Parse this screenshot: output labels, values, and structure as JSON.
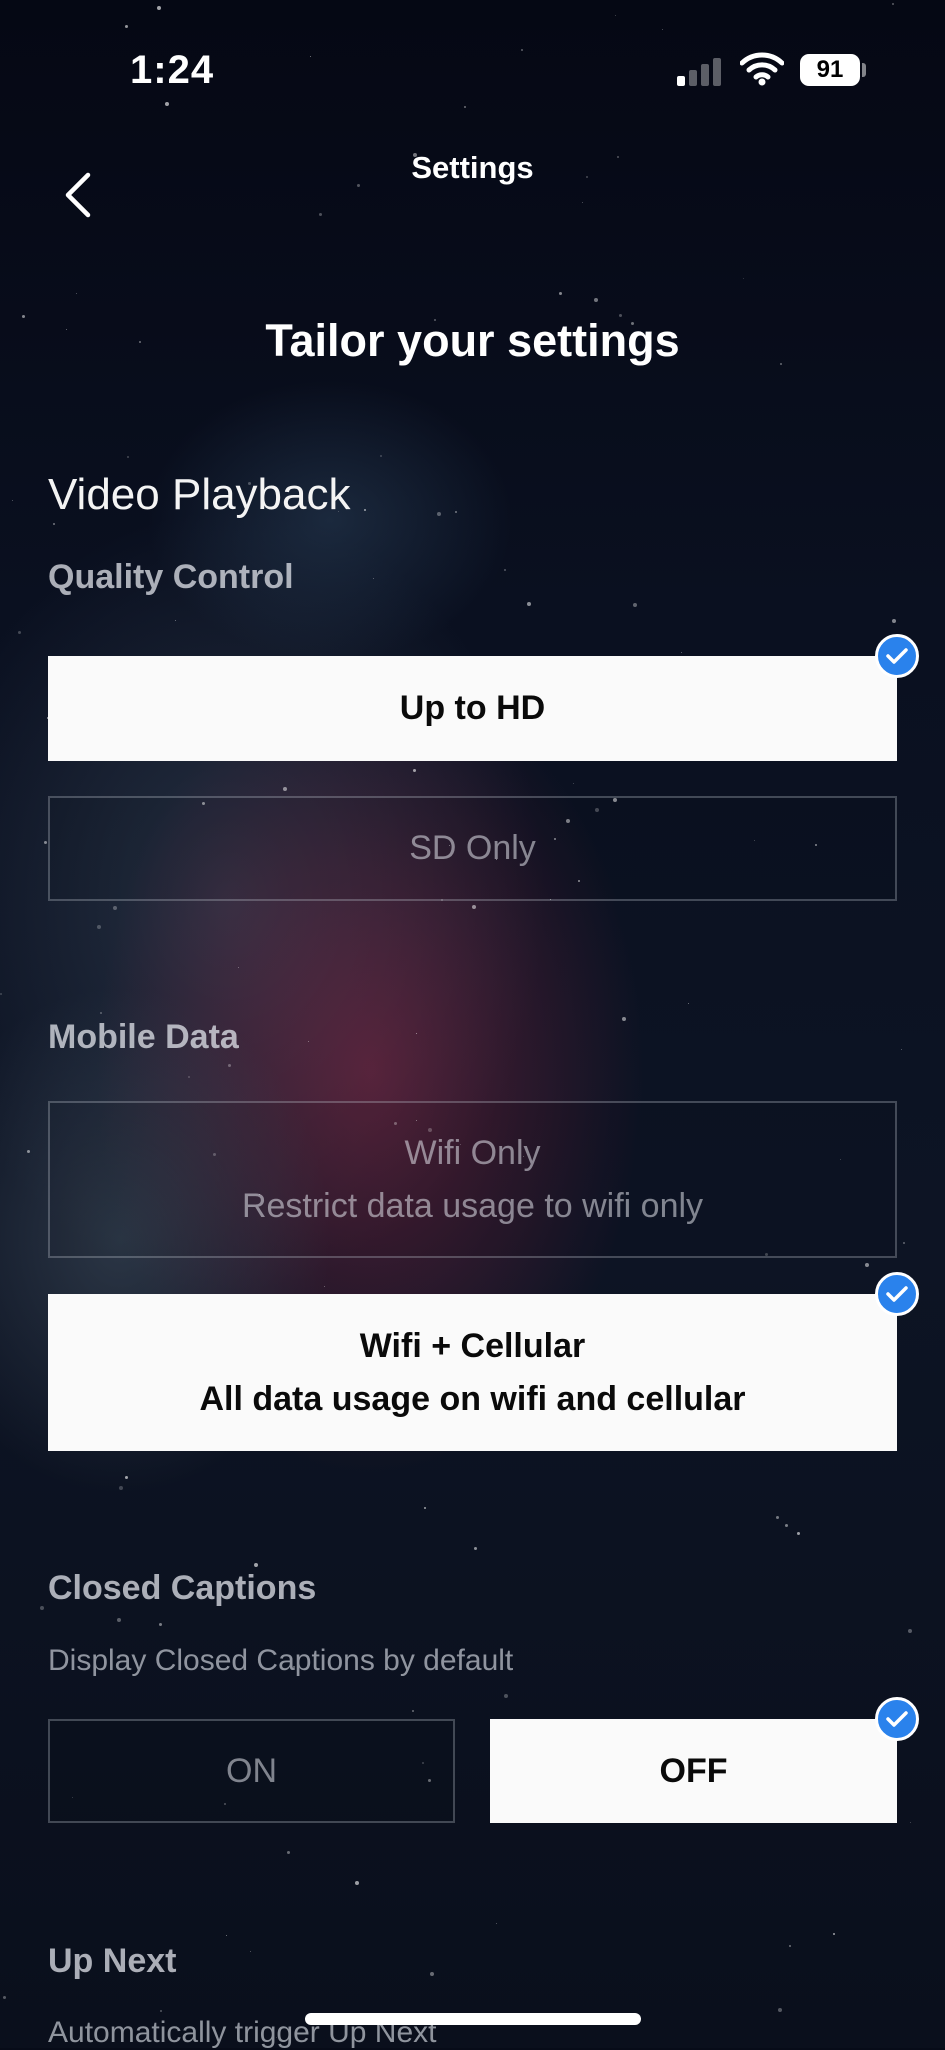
{
  "status_bar": {
    "time": "1:24",
    "battery": "91"
  },
  "nav": {
    "title": "Settings",
    "back_icon": "chevron-left-icon"
  },
  "page": {
    "heading": "Tailor your settings"
  },
  "video_playback": {
    "section_title": "Video Playback",
    "quality_control": {
      "label": "Quality Control",
      "options": [
        {
          "label": "Up to HD",
          "selected": true
        },
        {
          "label": "SD Only",
          "selected": false
        }
      ]
    },
    "mobile_data": {
      "label": "Mobile Data",
      "options": [
        {
          "title": "Wifi Only",
          "subtitle": "Restrict data usage to wifi only",
          "selected": false
        },
        {
          "title": "Wifi + Cellular",
          "subtitle": "All data usage on wifi and cellular",
          "selected": true
        }
      ]
    },
    "closed_captions": {
      "label": "Closed Captions",
      "description": "Display Closed Captions by default",
      "options": [
        {
          "label": "ON",
          "selected": false
        },
        {
          "label": "OFF",
          "selected": true
        }
      ]
    },
    "up_next": {
      "label": "Up Next",
      "description": "Automatically trigger Up Next"
    }
  },
  "colors": {
    "check_badge": "#2a82ec",
    "selected_bg": "#fafafa",
    "background": "#070b18"
  }
}
